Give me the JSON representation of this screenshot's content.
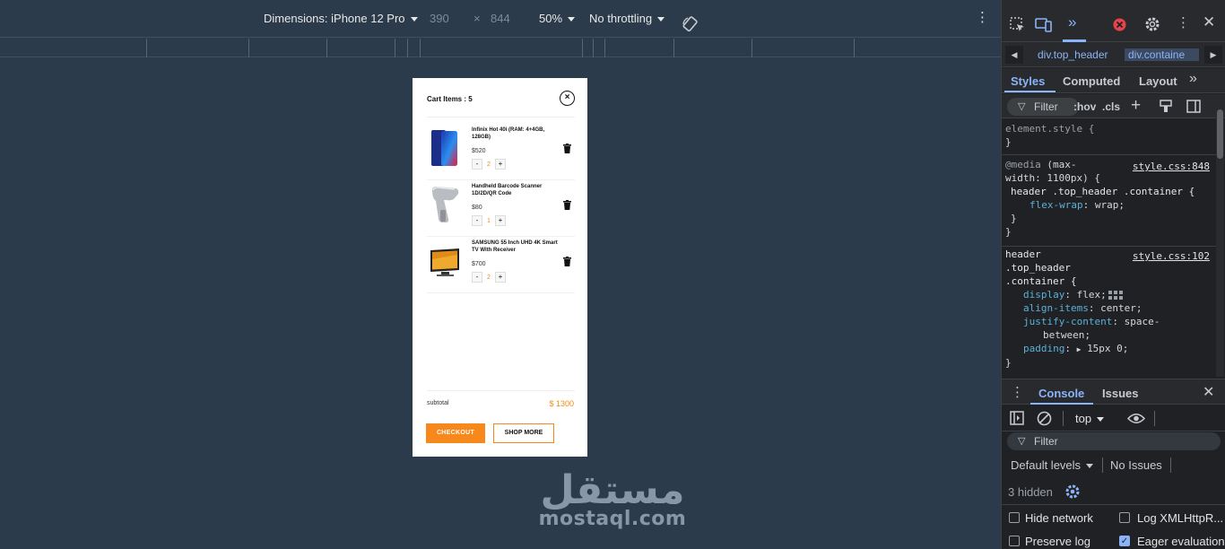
{
  "device_toolbar": {
    "dimensions_label": "Dimensions: iPhone 12 Pro",
    "width": "390",
    "times": "×",
    "height": "844",
    "zoom": "50%",
    "throttling": "No throttling"
  },
  "cart": {
    "title": "Cart Items : 5",
    "close_icon": "×",
    "items": [
      {
        "name": "Infinix Hot 40i (RAM: 4+4GB, 128GB)",
        "price": "$520",
        "qty": "2",
        "minus": "-",
        "plus": "+"
      },
      {
        "name": "Handheld Barcode Scanner 1D/2D/QR Code",
        "price": "$80",
        "qty": "1",
        "minus": "-",
        "plus": "+"
      },
      {
        "name": "SAMSUNG 55 Inch UHD 4K Smart TV With Receiver",
        "price": "$700",
        "qty": "2",
        "minus": "-",
        "plus": "+"
      }
    ],
    "subtotal_label": "subtotal",
    "subtotal_value": "$ 1300",
    "checkout_label": "CHECKOUT",
    "shop_more_label": "SHOP MORE"
  },
  "watermark": {
    "arabic": "مستقل",
    "latin": "mostaql.com"
  },
  "devtools": {
    "breadcrumbs": [
      "div.top_header",
      "div.containe"
    ],
    "tabs": [
      "Styles",
      "Computed",
      "Layout"
    ],
    "filter_placeholder": "Filter",
    "hov": ":hov",
    "cls": ".cls",
    "styles": {
      "element_style": "element.style {",
      "close_brace": "}",
      "media_rule": {
        "at": "@media",
        "query_1": " (max-",
        "query_2": "width: 1100px) {",
        "source": "style.css:848",
        "selector": "header .top_header .container {",
        "prop": "flex-wrap",
        "value": "wrap;"
      },
      "main_rule": {
        "sel_1": "header",
        "sel_2": ".top_header",
        "sel_3": ".container {",
        "source": "style.css:102",
        "display_prop": "display",
        "display_val": "flex;",
        "align_prop": "align-items",
        "align_val": "center;",
        "justify_prop": "justify-content",
        "justify_val_1": "space-",
        "justify_val_2": "between;",
        "padding_prop": "padding",
        "padding_val": "15px 0;"
      }
    },
    "console": {
      "tabs": [
        "Console",
        "Issues"
      ],
      "context": "top",
      "filter_placeholder": "Filter",
      "levels": "Default levels",
      "issues": "No Issues",
      "hidden": "3 hidden",
      "options": [
        {
          "label": "Hide network",
          "checked": false
        },
        {
          "label": "Log XMLHttpR...",
          "checked": false
        },
        {
          "label": "Preserve log",
          "checked": false
        },
        {
          "label": "Eager evaluation",
          "checked": true
        }
      ]
    }
  },
  "colors": {
    "accent": "#f7891c",
    "devtools_blue": "#8ab4f8",
    "page_bg": "#2c3b4b"
  }
}
